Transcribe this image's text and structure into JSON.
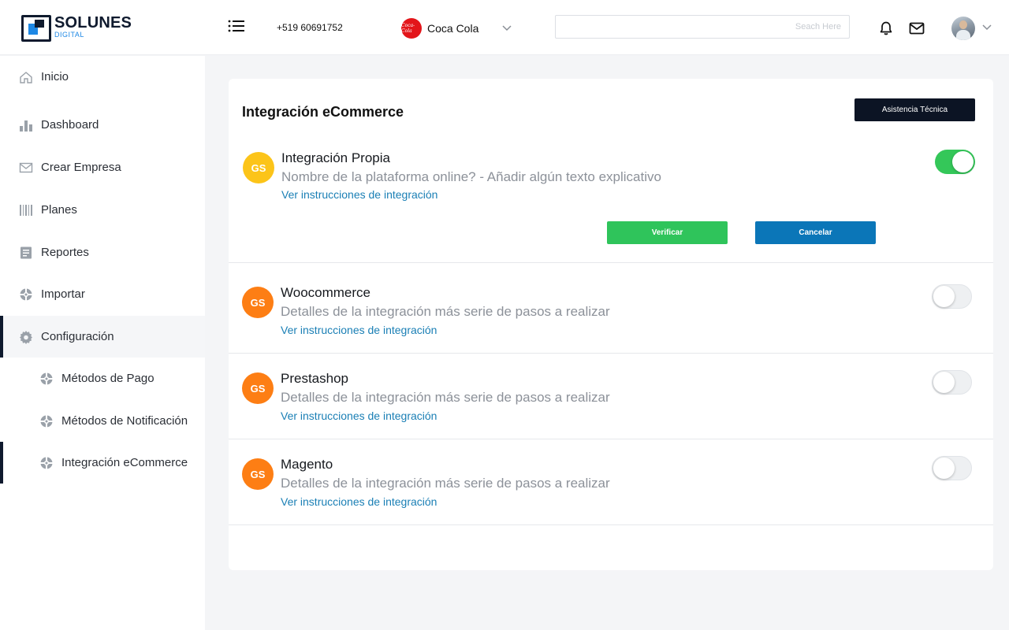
{
  "brand": {
    "name": "SOLUNES",
    "sub": "DIGITAL"
  },
  "header": {
    "phone": "+519 60691752",
    "company": {
      "name": "Coca Cola",
      "logo_text": "Coca-Cola",
      "logo_color": "#e3151a"
    },
    "search_placeholder": "Seach Here"
  },
  "sidebar": {
    "items": [
      {
        "label": "Inicio",
        "icon": "home-icon"
      },
      {
        "label": "Dashboard",
        "icon": "bar-chart-icon"
      },
      {
        "label": "Crear Empresa",
        "icon": "envelope-icon"
      },
      {
        "label": "Planes",
        "icon": "barcode-icon"
      },
      {
        "label": "Reportes",
        "icon": "report-icon"
      },
      {
        "label": "Importar",
        "icon": "globe-icon"
      },
      {
        "label": "Configuración",
        "icon": "gear-icon",
        "active": true
      },
      {
        "label": "Métodos de Pago",
        "icon": "globe-icon",
        "sub": true
      },
      {
        "label": "Métodos de Notificación",
        "icon": "globe-icon",
        "sub": true
      },
      {
        "label": "Integración eCommerce",
        "icon": "globe-icon",
        "sub": true,
        "current": true
      }
    ]
  },
  "main": {
    "title": "Integración eCommerce",
    "assist_label": "Asistencia Técnica",
    "verify_label": "Verificar",
    "cancel_label": "Cancelar",
    "integrations": [
      {
        "badge": "GS",
        "badge_color": "#fcc419",
        "title": "Integración Propia",
        "desc": "Nombre de la plataforma online? - Añadir algún texto explicativo",
        "link": "Ver instrucciones de integración",
        "enabled": true
      },
      {
        "badge": "GS",
        "badge_color": "#fd7e14",
        "title": "Woocommerce",
        "desc": "Detalles de la integración más serie de pasos a realizar",
        "link": "Ver instrucciones de integración",
        "enabled": false
      },
      {
        "badge": "GS",
        "badge_color": "#fd7e14",
        "title": "Prestashop",
        "desc": "Detalles de la integración más serie de pasos a realizar",
        "link": "Ver instrucciones de integración",
        "enabled": false
      },
      {
        "badge": "GS",
        "badge_color": "#fd7e14",
        "title": "Magento",
        "desc": "Detalles de la integración más serie de pasos a realizar",
        "link": "Ver instrucciones de integración",
        "enabled": false
      }
    ]
  },
  "colors": {
    "accent_dark": "#0c1424",
    "link": "#1a7fb5",
    "toggle_on": "#34c759",
    "verify": "#2fc45b",
    "cancel": "#0b76b8"
  }
}
